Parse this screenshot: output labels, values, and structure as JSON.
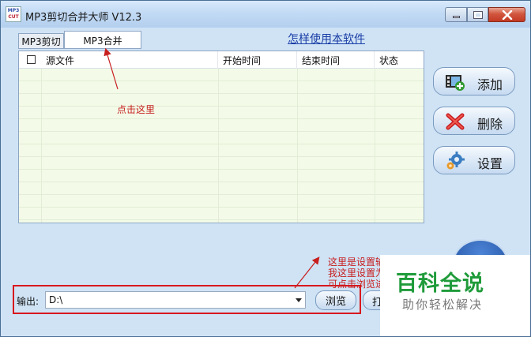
{
  "window": {
    "title": "MP3剪切合并大师 V12.3",
    "logo_top": "MP3",
    "logo_bottom": "CUT"
  },
  "title_buttons": {
    "minimize": "minimize-icon",
    "maximize": "maximize-icon",
    "close_glyph": "x"
  },
  "tabs": [
    {
      "label": "MP3剪切",
      "selected": false
    },
    {
      "label": "MP3合并",
      "selected": true
    }
  ],
  "help_link": "怎样使用本软件",
  "file_list": {
    "columns": [
      "源文件",
      "开始时间",
      "结束时间",
      "状态"
    ],
    "select_all_checked": false,
    "rows": []
  },
  "side_buttons": [
    {
      "label": "添加",
      "icon": "film-add-icon"
    },
    {
      "label": "删除",
      "icon": "red-x-icon"
    },
    {
      "label": "设置",
      "icon": "gear-icon"
    }
  ],
  "output": {
    "label": "输出:",
    "path": "D:\\",
    "browse_label": "浏览",
    "open_label_partial": "打"
  },
  "annotations": {
    "click_here": "点击这里",
    "hint_line1": "这里是设置输",
    "hint_line2": "我这里设置为",
    "hint_line3": "可点击浏览进",
    "color": "#d8181e"
  },
  "watermark": {
    "title": "百科全说",
    "subtitle": "助你轻松解决",
    "color": "#1f9b3a"
  },
  "colors": {
    "window_bg": "#cfe3f5",
    "list_bg": "#f3fbe8",
    "link": "#1b3ea6"
  }
}
